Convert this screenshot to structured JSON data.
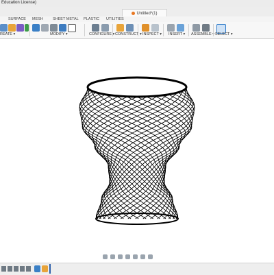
{
  "titlebar": {
    "app_text": "Education License)",
    "doc_title": "Untitled*(1)"
  },
  "workspace_tabs": [
    {
      "label": "SURFACE"
    },
    {
      "label": "MESH"
    },
    {
      "label": "SHEET METAL"
    },
    {
      "label": "PLASTIC"
    },
    {
      "label": "UTILITIES"
    }
  ],
  "ribbon_groups": [
    {
      "label": "REATE ▾"
    },
    {
      "label": "MODIFY ▾"
    },
    {
      "label": "CONFIGURE ▾"
    },
    {
      "label": "CONSTRUCT ▾"
    },
    {
      "label": "INSPECT ▾"
    },
    {
      "label": "INSERT ▾"
    },
    {
      "label": "ASSEMBLE ▾"
    },
    {
      "label": "SELECT ▾"
    }
  ],
  "colors": {
    "accent": "#2a78c8",
    "orange": "#e87722",
    "model_line": "#000000"
  },
  "icons": {
    "tab": "document-icon",
    "nav": [
      "orbit-icon",
      "pan-icon",
      "zoom-icon",
      "fit-icon",
      "display-icon",
      "grid-icon",
      "view-icon"
    ]
  }
}
